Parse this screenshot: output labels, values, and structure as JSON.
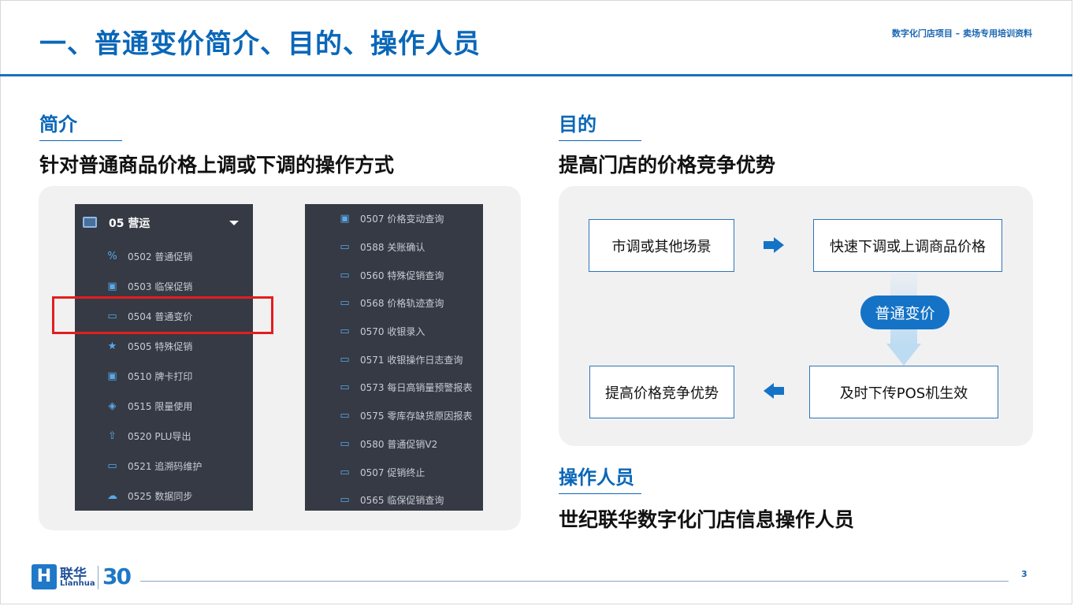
{
  "header": {
    "title": "一、普通变价简介、目的、操作人员",
    "note": "数字化门店项目 – 卖场专用培训资料"
  },
  "intro": {
    "label": "简介",
    "heading": "针对普通商品价格上调或下调的操作方式"
  },
  "purpose": {
    "label": "目的",
    "heading": "提高门店的价格竞争优势"
  },
  "operators": {
    "label": "操作人员",
    "heading": "世纪联华数字化门店信息操作人员"
  },
  "menu_left": {
    "header": "05 营运",
    "header_icon": "monitor-icon",
    "items": [
      {
        "label": "0502 普通促销",
        "icon": "percent-icon"
      },
      {
        "label": "0503 临保促销",
        "icon": "card-icon"
      },
      {
        "label": "0504 普通变价",
        "icon": "cart-icon"
      },
      {
        "label": "0505 特殊促销",
        "icon": "star-icon"
      },
      {
        "label": "0510 牌卡打印",
        "icon": "card-icon"
      },
      {
        "label": "0515 限量使用",
        "icon": "shield-icon"
      },
      {
        "label": "0520 PLU导出",
        "icon": "upload-icon"
      },
      {
        "label": "0521 追溯码维护",
        "icon": "cart-icon"
      },
      {
        "label": "0525 数据同步",
        "icon": "cloud-upload-icon"
      }
    ]
  },
  "menu_right": {
    "items": [
      {
        "label": "0507 价格变动查询",
        "icon": "card-icon"
      },
      {
        "label": "0588 关账确认",
        "icon": "cart-icon"
      },
      {
        "label": "0560 特殊促销查询",
        "icon": "cart-icon"
      },
      {
        "label": "0568 价格轨迹查询",
        "icon": "cart-icon"
      },
      {
        "label": "0570 收银录入",
        "icon": "cart-icon"
      },
      {
        "label": "0571 收银操作日志查询",
        "icon": "cart-icon"
      },
      {
        "label": "0573 每日高销量预警报表",
        "icon": "cart-icon"
      },
      {
        "label": "0575 零库存缺货原因报表",
        "icon": "cart-icon"
      },
      {
        "label": "0580 普通促销V2",
        "icon": "cart-icon"
      },
      {
        "label": "0507 促销终止",
        "icon": "cart-icon"
      },
      {
        "label": "0565 临保促销查询",
        "icon": "cart-icon"
      }
    ]
  },
  "flow": {
    "step1": "市调或其他场景",
    "step2": "快速下调或上调商品价格",
    "center": "普通变价",
    "step3": "及时下传POS机生效",
    "step4": "提高价格竞争优势"
  },
  "footer": {
    "logo_cn": "联华",
    "logo_en": "Lianhua",
    "logo_30": "30",
    "page_number": "3"
  },
  "colors": {
    "brand_blue": "#0a67b8",
    "menu_bg": "#353a44",
    "highlight_red": "#e21e1e",
    "pill_blue": "#1473c6"
  }
}
